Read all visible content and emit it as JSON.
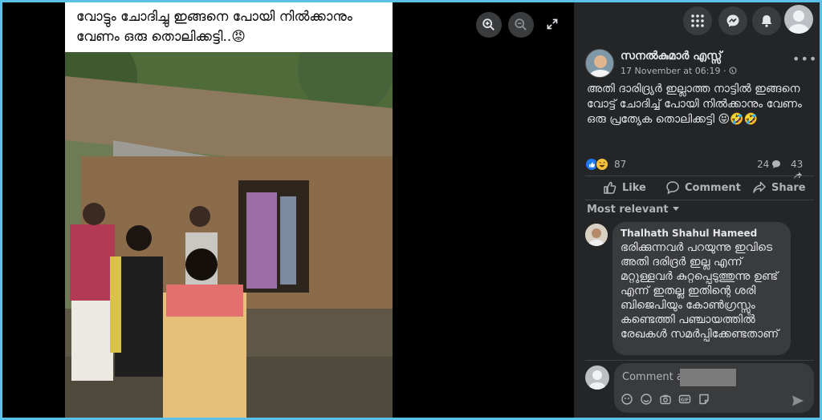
{
  "viewer": {
    "caption": "വോട്ടും ചോദിച്ചു ഇങ്ങനെ പോയി നിൽക്കാനും വേണം ഒരു തൊലിക്കട്ടി..😡",
    "icons": [
      "zoom-in-icon",
      "zoom-out-icon",
      "expand-icon"
    ]
  },
  "topbar": {
    "icons": [
      "menu-grid-icon",
      "messenger-icon",
      "notifications-bell-icon",
      "account-avatar"
    ]
  },
  "post": {
    "author": "സനൽകുമാർ എസ്സ്",
    "timestamp": "17 November at 06:19",
    "privacy_separator": "·",
    "text": "അതി ദാരിദ്ര്യർ ഇല്ലാത്ത നാട്ടിൽ ഇങ്ങനെ വോട്ട് ചോദിച്ച് പോയി നിൽക്കാനും വേണം ഒരു പ്രത്യേക തൊലിക്കട്ടി 😝🤣🤣",
    "reaction_count": "87",
    "comment_count": "24",
    "share_count": "43",
    "actions": {
      "like": "Like",
      "comment": "Comment",
      "share": "Share"
    }
  },
  "comments": {
    "sort_label": "Most relevant",
    "items": [
      {
        "author": "Thalhath Shahul Hameed",
        "text": "ഭരിക്കുന്നവർ പറയുന്നു ഇവിടെ അതി ദരിദ്രർ ഇല്ല എന്ന് മറ്റുള്ളവർ കുറ്റപ്പെടുത്തുന്നു ഉണ്ട് എന്ന് ഇതല്ല ഇതിന്റെ ശരി ബിജെപിയും കോൺഗ്രസ്സും കണ്ടെത്തി പഞ്ചായത്തിൽ രേഖകൾ സമർപ്പിക്കേണ്ടതാണ്"
      }
    ],
    "compose_placeholder": "Comment as"
  },
  "colors": {
    "panel_bg": "#242526",
    "bubble_bg": "#3a3b3c",
    "text_primary": "#e4e6eb",
    "text_secondary": "#b0b3b8",
    "like_blue": "#2078f4",
    "frame_border": "#5cc1e8"
  }
}
